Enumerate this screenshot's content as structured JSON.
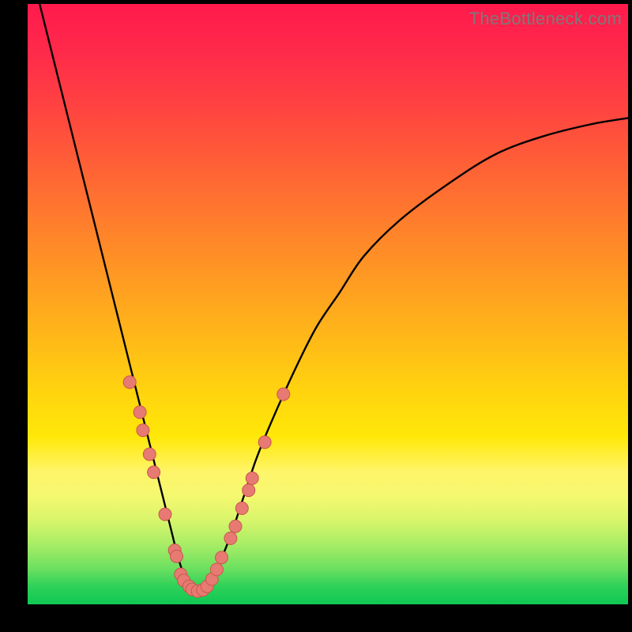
{
  "watermark": "TheBottleneck.com",
  "colors": {
    "background_black": "#000000",
    "dot_fill": "#e77a72",
    "dot_stroke": "#c9574e",
    "curve_stroke": "#000000",
    "gradient_top": "#ff1a4d",
    "gradient_bottom": "#0ec853"
  },
  "chart_data": {
    "type": "line",
    "title": "",
    "xlabel": "",
    "ylabel": "",
    "xlim": [
      0,
      100
    ],
    "ylim": [
      0,
      100
    ],
    "grid": false,
    "legend": false,
    "annotations": [],
    "series": [
      {
        "name": "curve",
        "x": [
          2,
          4,
          6,
          8,
          10,
          12,
          14,
          16,
          18,
          20,
          21,
          22,
          23,
          24,
          25,
          26,
          27,
          28,
          29,
          30,
          32,
          34,
          36,
          38,
          40,
          44,
          48,
          52,
          56,
          62,
          70,
          78,
          86,
          94,
          100
        ],
        "y": [
          100,
          92,
          84,
          76,
          68,
          60,
          52,
          44,
          36,
          28,
          24,
          20,
          16,
          12,
          8,
          5,
          3,
          2,
          2,
          3,
          7,
          12,
          18,
          24,
          29,
          38,
          46,
          52,
          58,
          64,
          70,
          75,
          78,
          80,
          81
        ]
      }
    ],
    "points": [
      {
        "x_pct": 17.0,
        "y_pct": 37
      },
      {
        "x_pct": 18.7,
        "y_pct": 32
      },
      {
        "x_pct": 19.2,
        "y_pct": 29
      },
      {
        "x_pct": 20.3,
        "y_pct": 25
      },
      {
        "x_pct": 21.0,
        "y_pct": 22
      },
      {
        "x_pct": 22.9,
        "y_pct": 15
      },
      {
        "x_pct": 24.5,
        "y_pct": 9
      },
      {
        "x_pct": 24.8,
        "y_pct": 8
      },
      {
        "x_pct": 25.5,
        "y_pct": 5
      },
      {
        "x_pct": 26.0,
        "y_pct": 4
      },
      {
        "x_pct": 26.9,
        "y_pct": 3
      },
      {
        "x_pct": 27.4,
        "y_pct": 2.5
      },
      {
        "x_pct": 28.3,
        "y_pct": 2.2
      },
      {
        "x_pct": 29.2,
        "y_pct": 2.4
      },
      {
        "x_pct": 29.9,
        "y_pct": 3.0
      },
      {
        "x_pct": 30.7,
        "y_pct": 4.2
      },
      {
        "x_pct": 31.5,
        "y_pct": 5.8
      },
      {
        "x_pct": 32.3,
        "y_pct": 7.8
      },
      {
        "x_pct": 33.8,
        "y_pct": 11
      },
      {
        "x_pct": 34.6,
        "y_pct": 13
      },
      {
        "x_pct": 35.7,
        "y_pct": 16
      },
      {
        "x_pct": 36.8,
        "y_pct": 19
      },
      {
        "x_pct": 37.4,
        "y_pct": 21
      },
      {
        "x_pct": 39.5,
        "y_pct": 27
      },
      {
        "x_pct": 42.6,
        "y_pct": 35
      }
    ],
    "dot_radius": 8
  }
}
